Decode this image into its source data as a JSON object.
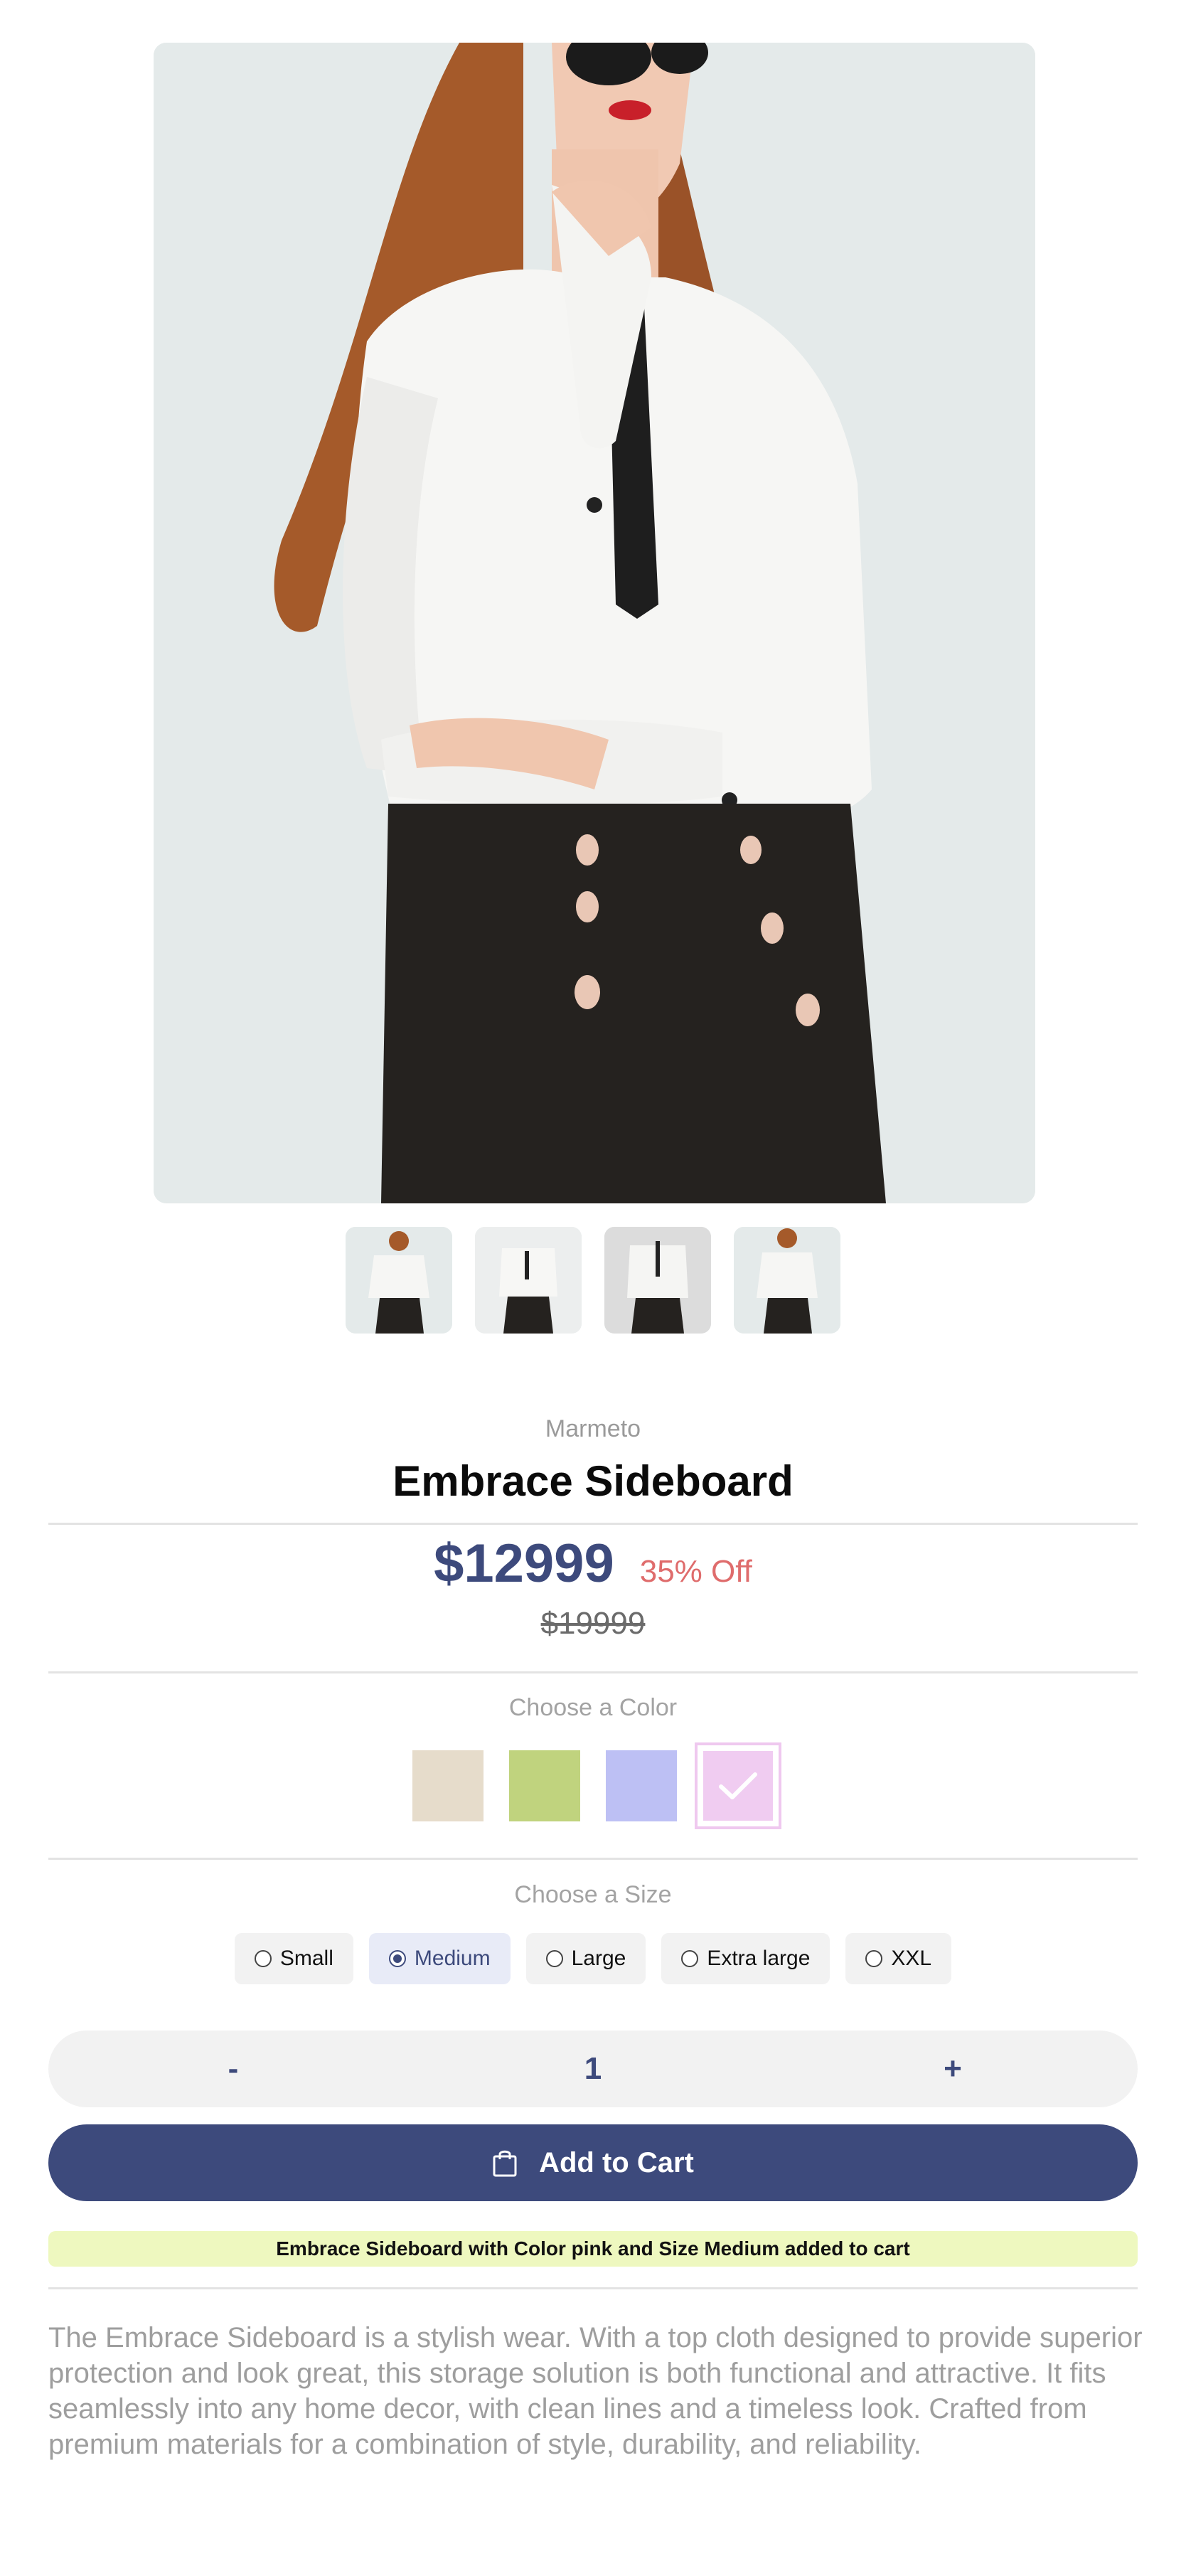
{
  "product": {
    "vendor": "Marmeto",
    "title": "Embrace Sideboard",
    "price": "$12999",
    "discount": "35% Off",
    "compare_price": "$19999",
    "description": "The Embrace Sideboard is a stylish wear. With a top cloth designed to provide superior protection and look great, this storage solution is both functional and attractive. It fits seamlessly into any home decor, with clean lines and a timeless look. Crafted from premium materials for a combination of style, durability, and reliability."
  },
  "gallery": {
    "main_image_icon": "woman-in-white-blouse-photo",
    "thumbnail_count": 4
  },
  "color": {
    "label": "Choose a Color",
    "swatches": [
      {
        "name": "beige",
        "hex": "#e6dccb",
        "selected": false
      },
      {
        "name": "green",
        "hex": "#c0d37e",
        "selected": false
      },
      {
        "name": "blue",
        "hex": "#bdc0f4",
        "selected": false
      },
      {
        "name": "pink",
        "hex": "#f0ccf1",
        "selected": true
      }
    ]
  },
  "size": {
    "label": "Choose a Size",
    "options": [
      {
        "label": "Small",
        "selected": false
      },
      {
        "label": "Medium",
        "selected": true
      },
      {
        "label": "Large",
        "selected": false
      },
      {
        "label": "Extra large",
        "selected": false
      },
      {
        "label": "XXL",
        "selected": false
      }
    ]
  },
  "quantity": {
    "minus_label": "-",
    "value": "1",
    "plus_label": "+"
  },
  "cart": {
    "button_label": "Add to Cart",
    "icon": "shopping-bag-icon",
    "notice": "Embrace Sideboard with Color pink and Size Medium added to cart"
  },
  "colors": {
    "accent": "#3d4a7c",
    "discount": "#df6c6c",
    "notice_bg": "#eef8bf"
  }
}
